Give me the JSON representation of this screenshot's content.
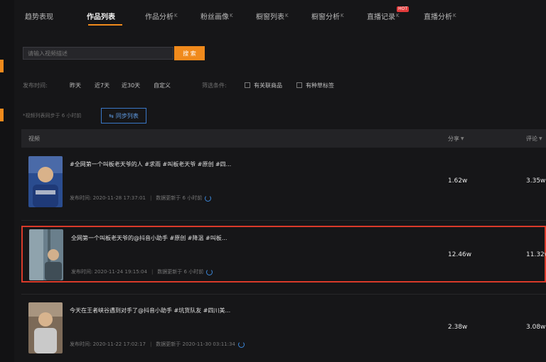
{
  "tabs": [
    {
      "label": "趋势表现",
      "tag": ""
    },
    {
      "label": "作品列表",
      "tag": ""
    },
    {
      "label": "作品分析",
      "tag": "K"
    },
    {
      "label": "粉丝画像",
      "tag": "K"
    },
    {
      "label": "橱窗列表",
      "tag": "K"
    },
    {
      "label": "橱窗分析",
      "tag": "K"
    },
    {
      "label": "直播记录",
      "tag": "K",
      "badge": "HOT"
    },
    {
      "label": "直播分析",
      "tag": "K"
    }
  ],
  "search": {
    "placeholder": "请输入视频描述",
    "value": "请输入视频描述",
    "button": "搜 索"
  },
  "filters": {
    "time_label": "发布时间:",
    "time_options": [
      "昨天",
      "近7天",
      "近30天",
      "自定义"
    ],
    "condition_label": "筛选条件:",
    "conditions": [
      "有关联商品",
      "有种草标签"
    ]
  },
  "sync": {
    "note": "*视频列表同步于 6 小时前",
    "button": "同步列表",
    "icon": "sync-icon"
  },
  "table": {
    "headers": {
      "video": "视频",
      "share": "分享",
      "comment": "评论"
    },
    "rows": [
      {
        "title": "#全网第一个叫板老天爷的人 #求雨 #叫板老天爷 #原创 #四...",
        "publish": "发布时间: 2020-11-28 17:37:01",
        "update": "数据更新于 6 小时前",
        "share": "1.62w",
        "comment": "3.35w",
        "thumb_bg": "#2a4c8f"
      },
      {
        "title": "全网第一个叫板老天爷的@抖音小助手 #原创 #降温 #叫板...",
        "publish": "发布时间: 2020-11-24 19:15:04",
        "update": "数据更新于 6 小时前",
        "share": "12.46w",
        "comment": "11.32v",
        "thumb_bg": "#6a7f8c"
      },
      {
        "title": "今天在王者峡谷遇到对手了@抖音小助手 #坑货队友 #四川美...",
        "publish": "发布时间: 2020-11-22 17:02:17",
        "update": "数据更新于 2020-11-30 03:11:34",
        "share": "2.38w",
        "comment": "3.08w",
        "thumb_bg": "#7c6a58"
      }
    ]
  },
  "colors": {
    "accent": "#f08a1c",
    "highlight_border": "#d93a2a",
    "link_blue": "#3a86d8"
  }
}
